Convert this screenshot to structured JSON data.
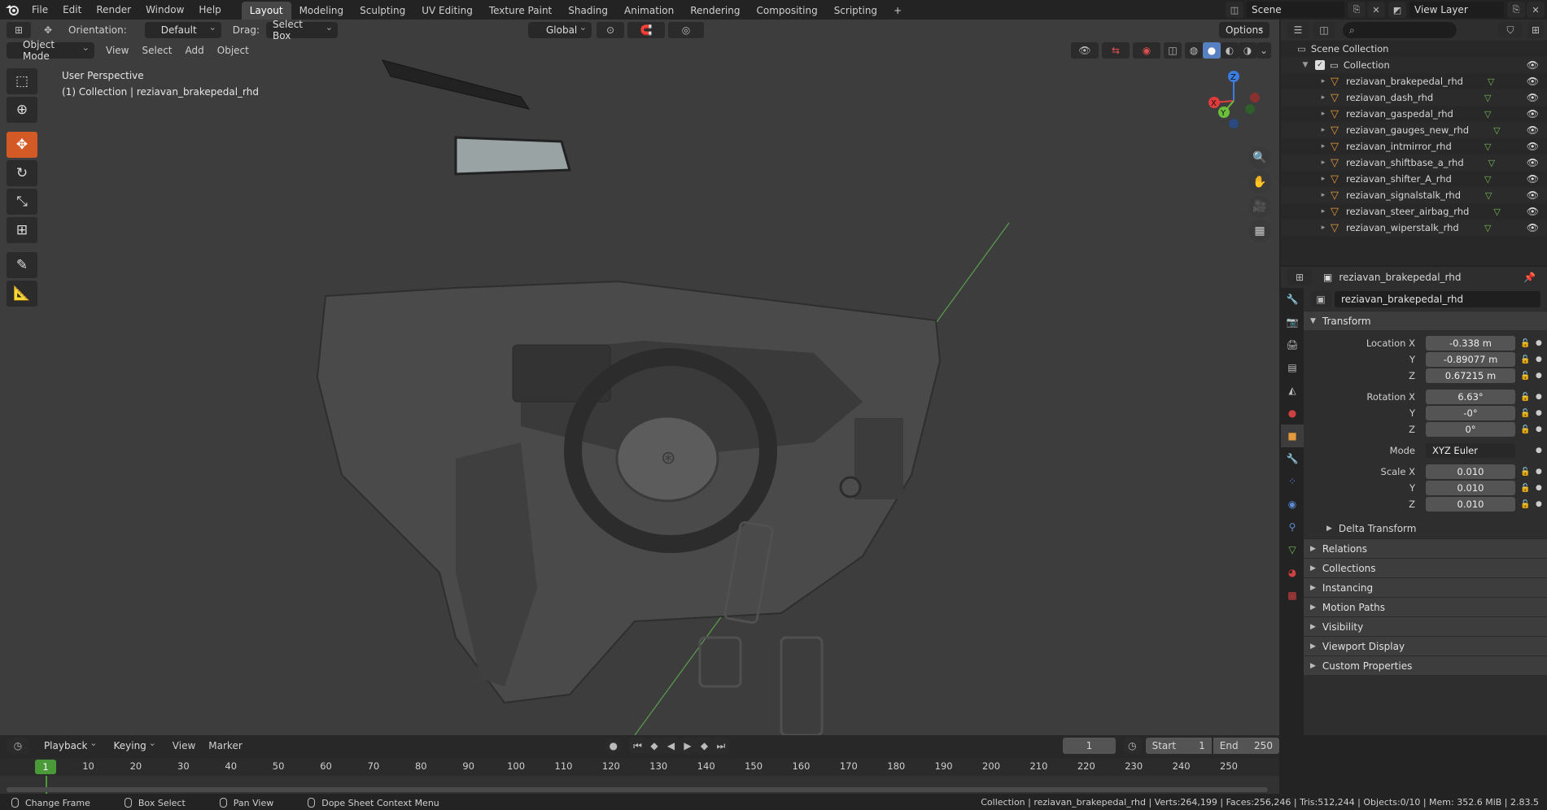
{
  "menu": [
    "File",
    "Edit",
    "Render",
    "Window",
    "Help"
  ],
  "workspaces": {
    "tabs": [
      "Layout",
      "Modeling",
      "Sculpting",
      "UV Editing",
      "Texture Paint",
      "Shading",
      "Animation",
      "Rendering",
      "Compositing",
      "Scripting"
    ],
    "active": "Layout",
    "add_label": "+"
  },
  "scene": "Scene",
  "view_layer": "View Layer",
  "viewport": {
    "orientation_label": "Orientation:",
    "orientation_value": "Default",
    "drag_label": "Drag:",
    "drag_value": "Select Box",
    "transform_orientation": "Global",
    "options_label": "Options",
    "mode": "Object Mode",
    "menus": [
      "View",
      "Select",
      "Add",
      "Object"
    ],
    "info_line1": "User Perspective",
    "info_line2": "(1) Collection | reziavan_brakepedal_rhd",
    "gizmo": {
      "x": "X",
      "y": "Y",
      "z": "Z"
    },
    "colors": {
      "background": "#3d3d3d",
      "active_tool": "#d35a25",
      "axis_x": "#e23b3b",
      "axis_y": "#6bbf3a",
      "axis_z": "#3b7de2"
    }
  },
  "tools": [
    "select-box",
    "cursor",
    "move",
    "rotate",
    "scale",
    "transform",
    "annotate",
    "measure"
  ],
  "outliner": {
    "root": "Scene Collection",
    "collection": "Collection",
    "objects": [
      "reziavan_brakepedal_rhd",
      "reziavan_dash_rhd",
      "reziavan_gaspedal_rhd",
      "reziavan_gauges_new_rhd",
      "reziavan_intmirror_rhd",
      "reziavan_shiftbase_a_rhd",
      "reziavan_shifter_A_rhd",
      "reziavan_signalstalk_rhd",
      "reziavan_steer_airbag_rhd",
      "reziavan_wiperstalk_rhd"
    ]
  },
  "properties": {
    "context_name": "reziavan_brakepedal_rhd",
    "object_name": "reziavan_brakepedal_rhd",
    "transform_title": "Transform",
    "location": {
      "label": "Location X",
      "x": "-0.338 m",
      "y": "-0.89077 m",
      "z": "0.67215 m"
    },
    "rotation": {
      "label": "Rotation X",
      "x": "6.63°",
      "y": "-0°",
      "z": "0°"
    },
    "mode_label": "Mode",
    "mode_value": "XYZ Euler",
    "scale": {
      "label": "Scale X",
      "x": "0.010",
      "y": "0.010",
      "z": "0.010"
    },
    "axis_labels": {
      "y": "Y",
      "z": "Z"
    },
    "delta_transform": "Delta Transform",
    "sections": [
      "Relations",
      "Collections",
      "Instancing",
      "Motion Paths",
      "Visibility",
      "Viewport Display",
      "Custom Properties"
    ]
  },
  "timeline": {
    "menus": [
      "Playback",
      "Keying",
      "View",
      "Marker"
    ],
    "current_frame": "1",
    "start_label": "Start",
    "start": "1",
    "end_label": "End",
    "end": "250",
    "ticks": [
      "10",
      "20",
      "30",
      "40",
      "50",
      "60",
      "70",
      "80",
      "90",
      "100",
      "110",
      "120",
      "130",
      "140",
      "150",
      "160",
      "170",
      "180",
      "190",
      "200",
      "210",
      "220",
      "230",
      "240",
      "250"
    ],
    "cursor_label": "1"
  },
  "status": {
    "left": [
      "Change Frame",
      "Box Select",
      "Pan View",
      "Dope Sheet Context Menu"
    ],
    "stats": "Collection | reziavan_brakepedal_rhd | Verts:264,199 | Faces:256,246 | Tris:512,244 | Objects:0/10 | Mem: 352.6 MiB | 2.83.5"
  }
}
